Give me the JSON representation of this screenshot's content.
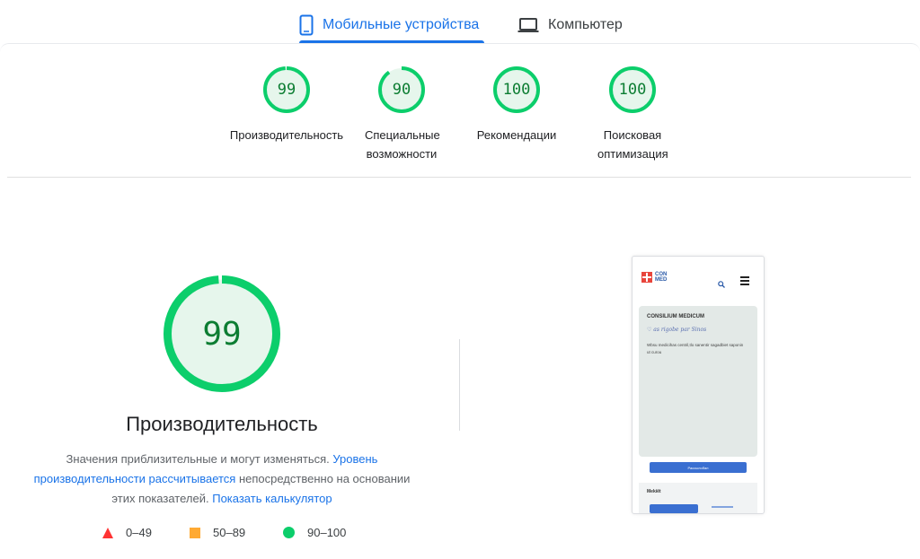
{
  "tabs": {
    "mobile_label": "Мобильные устройства",
    "desktop_label": "Компьютер"
  },
  "categories": [
    {
      "score": "99",
      "label": "Производительность",
      "percent": 99
    },
    {
      "score": "90",
      "label": "Специальные возможности",
      "percent": 90
    },
    {
      "score": "100",
      "label": "Рекомендации",
      "percent": 100
    },
    {
      "score": "100",
      "label": "Поисковая оптимизация",
      "percent": 100
    }
  ],
  "performance": {
    "score": "99",
    "percent": 99,
    "title": "Производительность",
    "desc_part1": "Значения приблизительные и могут изменяться. ",
    "desc_link1": "Уровень производительности рассчитывается",
    "desc_part2": " непосредственно на основании этих показателей. ",
    "desc_link2": "Показать калькулятор"
  },
  "legend": [
    {
      "range": "0–49",
      "icon": "red-triangle-icon"
    },
    {
      "range": "50–89",
      "icon": "orange-square-icon"
    },
    {
      "range": "90–100",
      "icon": "green-circle-icon"
    }
  ],
  "colors": {
    "accent": "#1a73e8",
    "pass_ring": "#0cce6b",
    "pass_text": "#0c7d32",
    "pass_fill": "#e6f6ec",
    "fail": "#ff3333",
    "average": "#ffaa33"
  },
  "screenshot": {
    "logo_text_line1": "CON",
    "logo_text_line2": "MED",
    "hero_title": "CONSILIUM MEDICUM",
    "hero_script": "♡ as rigobe par Sinos",
    "hero_text": "Wbsu medicihas centril,tlo sanentir sagadbiet saponin ut curou",
    "button_label": "Рассылобал",
    "bottom_title": "Mekiět"
  }
}
